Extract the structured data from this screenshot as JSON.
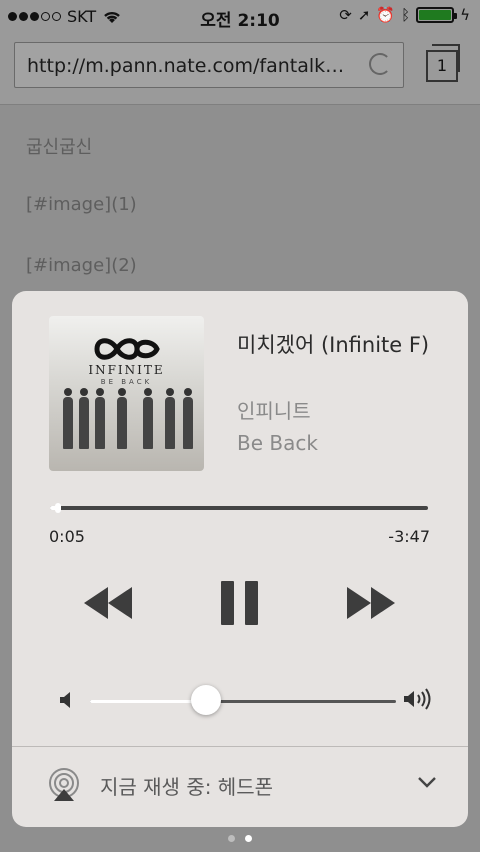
{
  "status_bar": {
    "carrier": "SKT",
    "time": "오전 2:10",
    "signal_bars_filled": 3,
    "signal_bars_total": 5,
    "battery_level": 1.0,
    "battery_color": "#1f7a1f"
  },
  "browser": {
    "url": "http://m.pann.nate.com/fantalk…",
    "tab_count": "1"
  },
  "page": {
    "lines": [
      "굽신굽신",
      "[#image](1)",
      "[#image](2)"
    ]
  },
  "player": {
    "title": "미치겠어 (Infinite F)",
    "artist": "인피니트",
    "album": "Be Back",
    "album_art_text": "INFINITE",
    "album_art_subtext": "BE BACK",
    "elapsed": "0:05",
    "remaining": "-3:47",
    "progress_fraction": 0.02,
    "volume_fraction": 0.38,
    "controls": [
      "rewind-icon",
      "pause-icon",
      "fast-forward-icon"
    ],
    "output_label": "지금 재생 중: 헤드폰"
  },
  "page_indicator": {
    "count": 2,
    "active_index": 1
  }
}
